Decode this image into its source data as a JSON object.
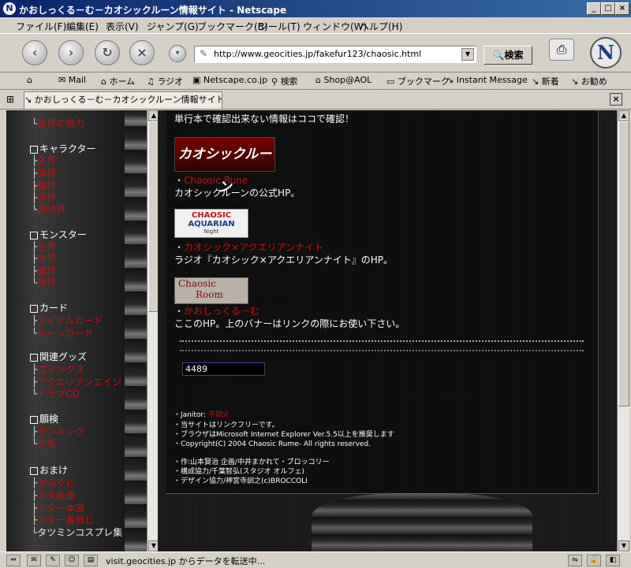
{
  "window": {
    "title": "かおしっくる－む－カオシックルーン情報サイト - Netscape",
    "minimize": "_",
    "maximize": "□",
    "close": "×"
  },
  "menu": [
    "ファイル(F)",
    "編集(E)",
    "表示(V)",
    "ジャンプ(G)",
    "ブックマーク(B)",
    "ツール(T)",
    "ウィンドウ(W)",
    "ヘルプ(H)"
  ],
  "nav": {
    "url": "http://www.geocities.jp/fakefur123/chaosic.html",
    "search_label": "検索"
  },
  "personal_toolbar": [
    "Mail",
    "ホーム",
    "ラジオ",
    "Netscape.co.jp",
    "検索",
    "Shop@AOL",
    "ブックマーク",
    "Instant Message",
    "新着",
    "お勧め"
  ],
  "tab": {
    "label": "かおしっくる－む－カオシックルーン情報サイト"
  },
  "left_menu": {
    "top_cut": "各界の勢力",
    "sections": [
      {
        "title": "キャラクター",
        "items": [
          "生界",
          "神界",
          "魔界",
          "冥界",
          "混沌界"
        ]
      },
      {
        "title": "モンスター",
        "items": [
          "生界",
          "神界",
          "魔界",
          "冥界"
        ]
      },
      {
        "title": "カード",
        "items": [
          "アイテムカード",
          "ルーンカード"
        ]
      },
      {
        "title": "関連グッズ",
        "items": [
          "コミックス",
          "アクエリアンエイジ",
          "ドラマCD"
        ]
      },
      {
        "title": "願検",
        "items": [
          "ランキング",
          "手帳"
        ]
      },
      {
        "title": "おまけ",
        "items": [
          "かみぐじ",
          "ネタ画像",
          "ネタ一本道",
          "ネタ一番煎じ",
          "タツミンコスプレ集"
        ]
      }
    ]
  },
  "main": {
    "intro": "単行本で確認出来ない情報はココで確認！",
    "links": [
      {
        "banner_text": "カオシックルーン",
        "link": "Chaosic Rune",
        "desc": "カオシックルーンの公式HP。"
      },
      {
        "banner_lines": [
          "CHAOSIC",
          "AQUARIAN",
          "Night"
        ],
        "link": "カオシック×アクエリアンナイト",
        "desc": "ラジオ『カオシック×アクエリアンナイト』のHP。"
      },
      {
        "banner_lines": [
          "Chaosic",
          "Room"
        ],
        "link": "かおしっくる－む",
        "desc": "ここのHP。上のバナーはリンクの際にお使い下さい。"
      }
    ],
    "counter": "4489",
    "footer": {
      "janitor_label": "Janitor:",
      "janitor_name": "不知火",
      "lines": [
        "当サイトはリンクフリーです。",
        "ブラウザはMicrosoft Internet Explorer Ver.5.5以上を推奨します",
        "Copyright(C) 2004 Chaosic Rume- All rights reserved.",
        "作:山本賢治 企画/中井まかれて・ブロッコリー",
        "構成協力/千葉智弘(スタジオ オルフェ)",
        "デザイン協力/神宮寺訓之(c)BROCCOLI"
      ]
    }
  },
  "status": {
    "text": "visit.geocities.jp からデータを転送中..."
  }
}
